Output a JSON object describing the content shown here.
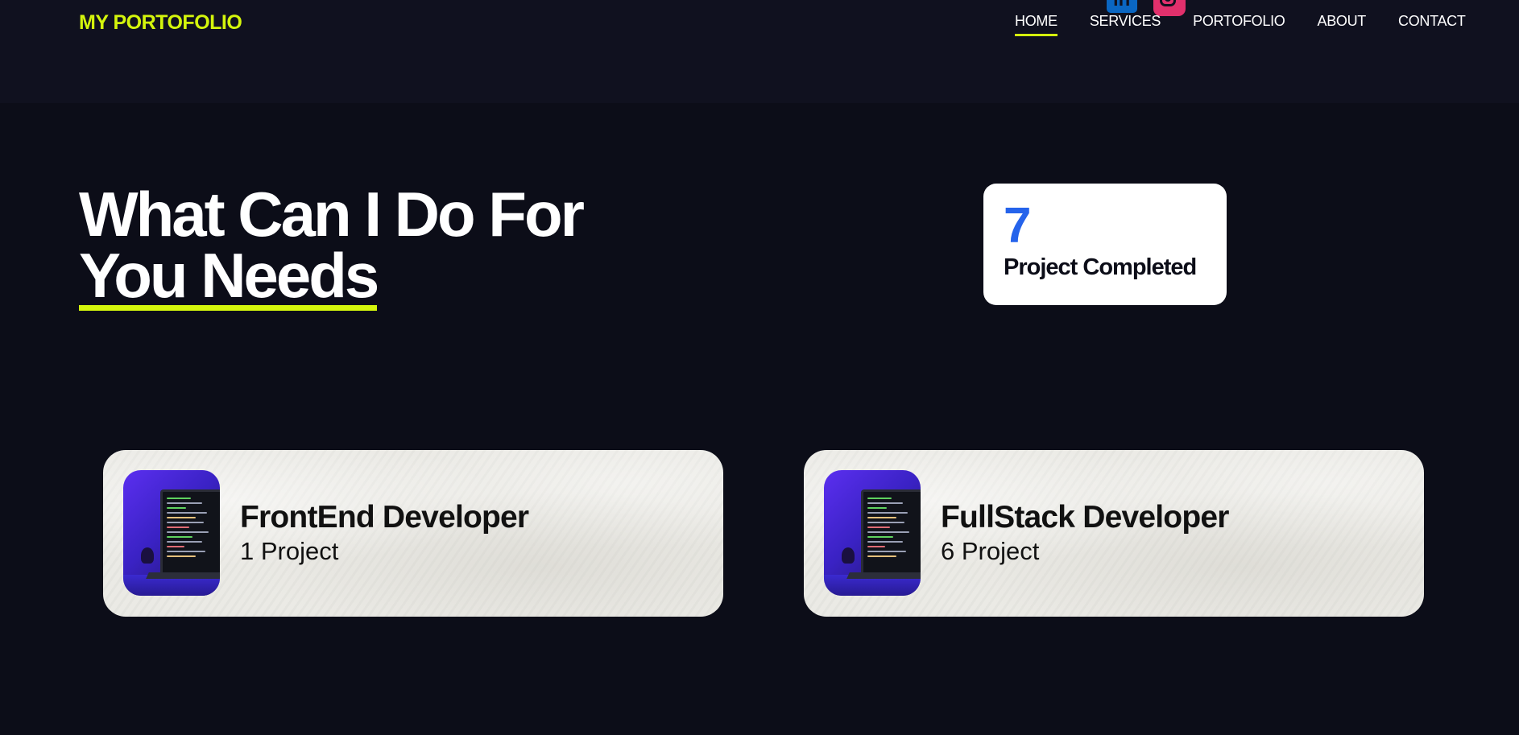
{
  "header": {
    "logo": "MY PORTOFOLIO",
    "nav": [
      {
        "label": "HOME",
        "active": true
      },
      {
        "label": "SERVICES",
        "active": false
      },
      {
        "label": "PORTOFOLIO",
        "active": false
      },
      {
        "label": "ABOUT",
        "active": false
      },
      {
        "label": "CONTACT",
        "active": false
      }
    ],
    "social": [
      "linkedin-icon",
      "instagram-icon"
    ]
  },
  "hero": {
    "title_line1": "What Can I Do For",
    "title_line2": "You Needs"
  },
  "stats": {
    "number": "7",
    "label": "Project Completed"
  },
  "services": [
    {
      "title": "FrontEnd Developer",
      "subtitle": "1 Project"
    },
    {
      "title": "FullStack Developer",
      "subtitle": "6 Project"
    }
  ],
  "colors": {
    "background": "#0c0d18",
    "header_background": "#10111f",
    "accent": "#d4f50c",
    "stat_number": "#2563eb",
    "linkedin": "#0a66c2",
    "instagram": "#e1306c"
  }
}
